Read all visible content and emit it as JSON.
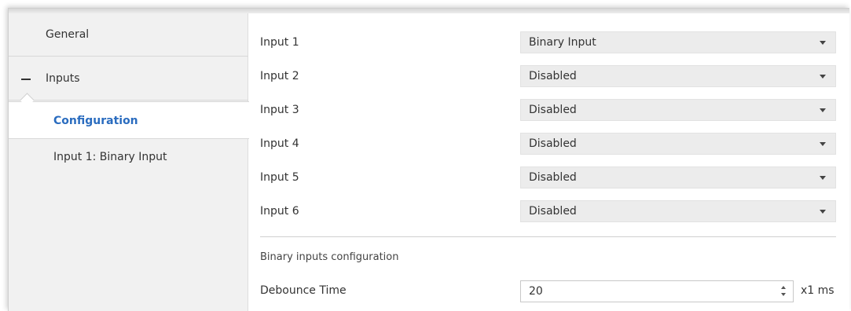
{
  "sidebar": {
    "items": [
      {
        "label": "General"
      },
      {
        "label": "Inputs"
      },
      {
        "label": "Configuration"
      },
      {
        "label": "Input 1: Binary Input"
      }
    ]
  },
  "main": {
    "inputs": [
      {
        "label": "Input 1",
        "value": "Binary Input"
      },
      {
        "label": "Input 2",
        "value": "Disabled"
      },
      {
        "label": "Input 3",
        "value": "Disabled"
      },
      {
        "label": "Input 4",
        "value": "Disabled"
      },
      {
        "label": "Input 5",
        "value": "Disabled"
      },
      {
        "label": "Input 6",
        "value": "Disabled"
      }
    ],
    "section_heading": "Binary inputs configuration",
    "debounce": {
      "label": "Debounce Time",
      "value": "20",
      "unit": "x1 ms"
    }
  },
  "colors": {
    "accent": "#2a6cbf",
    "sidebar_bg": "#f1f1f1",
    "select_bg": "#ececec"
  }
}
